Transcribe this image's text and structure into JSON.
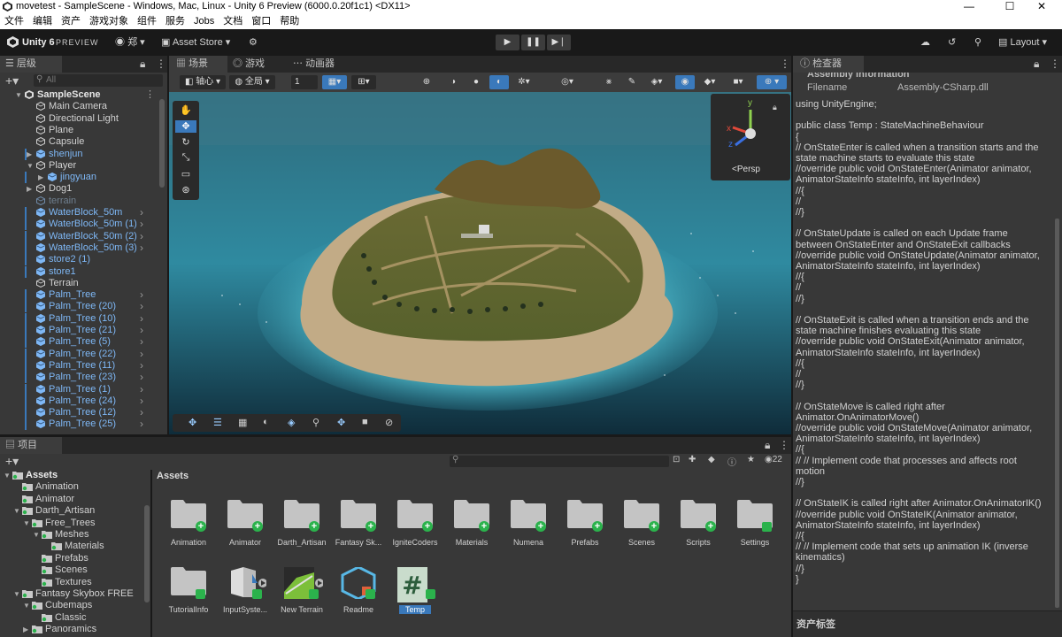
{
  "window": {
    "title": "movetest - SampleScene - Windows, Mac, Linux - Unity 6 Preview (6000.0.20f1c1) <DX11>",
    "minimize": "—",
    "maximize": "☐",
    "close": "✕"
  },
  "menubar": [
    "文件",
    "编辑",
    "资产",
    "游戏对象",
    "组件",
    "服务",
    "Jobs",
    "文档",
    "窗口",
    "帮助"
  ],
  "toolbar": {
    "logo_text": "Unity 6",
    "preview": "PREVIEW",
    "account": "郑",
    "asset_store": "Asset Store",
    "layout": "Layout"
  },
  "hierarchy": {
    "tab": "层级",
    "search_placeholder": "All",
    "items": [
      {
        "label": "SampleScene",
        "depth": 0,
        "expand": "open",
        "kind": "scene"
      },
      {
        "label": "Main Camera",
        "depth": 1,
        "kind": "object"
      },
      {
        "label": "Directional Light",
        "depth": 1,
        "kind": "object"
      },
      {
        "label": "Plane",
        "depth": 1,
        "kind": "object"
      },
      {
        "label": "Capsule",
        "depth": 1,
        "kind": "object"
      },
      {
        "label": "shenjun",
        "depth": 1,
        "expand": "closed",
        "kind": "prefab"
      },
      {
        "label": "Player",
        "depth": 1,
        "expand": "open",
        "kind": "object"
      },
      {
        "label": "jingyuan",
        "depth": 2,
        "expand": "closed",
        "kind": "prefab"
      },
      {
        "label": "Dog1",
        "depth": 1,
        "expand": "closed",
        "kind": "object"
      },
      {
        "label": "terrain",
        "depth": 1,
        "kind": "disabled"
      },
      {
        "label": "WaterBlock_50m",
        "depth": 1,
        "kind": "prefab",
        "child": true
      },
      {
        "label": "WaterBlock_50m (1)",
        "depth": 1,
        "kind": "prefab",
        "child": true
      },
      {
        "label": "WaterBlock_50m (2)",
        "depth": 1,
        "kind": "prefab",
        "child": true
      },
      {
        "label": "WaterBlock_50m (3)",
        "depth": 1,
        "kind": "prefab",
        "child": true
      },
      {
        "label": "store2 (1)",
        "depth": 1,
        "kind": "prefab"
      },
      {
        "label": "store1",
        "depth": 1,
        "kind": "prefab"
      },
      {
        "label": "Terrain",
        "depth": 1,
        "kind": "object"
      },
      {
        "label": "Palm_Tree",
        "depth": 1,
        "kind": "prefab",
        "child": true
      },
      {
        "label": "Palm_Tree (20)",
        "depth": 1,
        "kind": "prefab",
        "child": true
      },
      {
        "label": "Palm_Tree (10)",
        "depth": 1,
        "kind": "prefab",
        "child": true
      },
      {
        "label": "Palm_Tree (21)",
        "depth": 1,
        "kind": "prefab",
        "child": true
      },
      {
        "label": "Palm_Tree (5)",
        "depth": 1,
        "kind": "prefab",
        "child": true
      },
      {
        "label": "Palm_Tree (22)",
        "depth": 1,
        "kind": "prefab",
        "child": true
      },
      {
        "label": "Palm_Tree (11)",
        "depth": 1,
        "kind": "prefab",
        "child": true
      },
      {
        "label": "Palm_Tree (23)",
        "depth": 1,
        "kind": "prefab",
        "child": true
      },
      {
        "label": "Palm_Tree (1)",
        "depth": 1,
        "kind": "prefab",
        "child": true
      },
      {
        "label": "Palm_Tree (24)",
        "depth": 1,
        "kind": "prefab",
        "child": true
      },
      {
        "label": "Palm_Tree (12)",
        "depth": 1,
        "kind": "prefab",
        "child": true
      },
      {
        "label": "Palm_Tree (25)",
        "depth": 1,
        "kind": "prefab",
        "child": true
      }
    ]
  },
  "scene": {
    "tabs": [
      "场景",
      "游戏",
      "动画器"
    ],
    "pivot": "轴心",
    "global": "全局",
    "grid_value": "1",
    "gizmo_label": "Persp",
    "gizmo_axes": {
      "y": "y",
      "x": "x",
      "z": "z"
    }
  },
  "inspector": {
    "tab": "检查器",
    "section_header": "Assembly Information",
    "filename_label": "Filename",
    "filename_value": "Assembly-CSharp.dll",
    "code_lines": [
      "using UnityEngine;",
      "",
      "public class Temp : StateMachineBehaviour",
      "{",
      "    // OnStateEnter is called when a transition starts and the",
      "state machine starts to evaluate this state",
      "    //override public void OnStateEnter(Animator animator,",
      "AnimatorStateInfo stateInfo, int layerIndex)",
      "    //{",
      "    //",
      "    //}",
      "",
      "    // OnStateUpdate is called on each Update frame",
      "between OnStateEnter and OnStateExit callbacks",
      "    //override public void OnStateUpdate(Animator animator,",
      "AnimatorStateInfo stateInfo, int layerIndex)",
      "    //{",
      "    //",
      "    //}",
      "",
      "    // OnStateExit is called when a transition ends and the",
      "state machine finishes evaluating this state",
      "    //override public void OnStateExit(Animator animator,",
      "AnimatorStateInfo stateInfo, int layerIndex)",
      "    //{",
      "    //",
      "    //}",
      "",
      "    // OnStateMove is called right after",
      "Animator.OnAnimatorMove()",
      "    //override public void OnStateMove(Animator animator,",
      "AnimatorStateInfo stateInfo, int layerIndex)",
      "    //{",
      "    //    // Implement code that processes and affects root",
      "motion",
      "    //}",
      "",
      "    // OnStateIK is called right after Animator.OnAnimatorIK()",
      "    //override public void OnStateIK(Animator animator,",
      "AnimatorStateInfo stateInfo, int layerIndex)",
      "    //{",
      "    //    // Implement code that sets up animation IK (inverse",
      "kinematics)",
      "    //}",
      "}"
    ],
    "asset_labels": "资产标签"
  },
  "project": {
    "tab": "项目",
    "count": "22",
    "breadcrumb": "Assets",
    "tree": [
      {
        "label": "Assets",
        "depth": 0,
        "expand": "open",
        "bold": true
      },
      {
        "label": "Animation",
        "depth": 1
      },
      {
        "label": "Animator",
        "depth": 1
      },
      {
        "label": "Darth_Artisan",
        "depth": 1,
        "expand": "open"
      },
      {
        "label": "Free_Trees",
        "depth": 2,
        "expand": "open"
      },
      {
        "label": "Meshes",
        "depth": 3,
        "expand": "open"
      },
      {
        "label": "Materials",
        "depth": 4
      },
      {
        "label": "Prefabs",
        "depth": 3
      },
      {
        "label": "Scenes",
        "depth": 3
      },
      {
        "label": "Textures",
        "depth": 3
      },
      {
        "label": "Fantasy Skybox FREE",
        "depth": 1,
        "expand": "open"
      },
      {
        "label": "Cubemaps",
        "depth": 2,
        "expand": "open"
      },
      {
        "label": "Classic",
        "depth": 3
      },
      {
        "label": "Panoramics",
        "depth": 2,
        "expand": "closed"
      }
    ],
    "assets": [
      {
        "label": "Animation",
        "type": "folder"
      },
      {
        "label": "Animator",
        "type": "folder"
      },
      {
        "label": "Darth_Artisan",
        "type": "folder"
      },
      {
        "label": "Fantasy Sk...",
        "type": "folder"
      },
      {
        "label": "IgniteCoders",
        "type": "folder"
      },
      {
        "label": "Materials",
        "type": "folder"
      },
      {
        "label": "Numena",
        "type": "folder"
      },
      {
        "label": "Prefabs",
        "type": "folder"
      },
      {
        "label": "Scenes",
        "type": "folder"
      },
      {
        "label": "Scripts",
        "type": "folder"
      },
      {
        "label": "Settings",
        "type": "folder-check"
      },
      {
        "label": "TutorialInfo",
        "type": "folder-check"
      },
      {
        "label": "InputSyste...",
        "type": "input"
      },
      {
        "label": "New Terrain",
        "type": "terrain"
      },
      {
        "label": "Readme",
        "type": "readme"
      },
      {
        "label": "Temp",
        "type": "script"
      }
    ]
  },
  "colors": {
    "prefab_blue": "#7eb7f5",
    "accent_blue": "#3a79bb",
    "add_green": "#2bb24c",
    "panel_bg": "#383838",
    "tab_bg": "#282828"
  }
}
